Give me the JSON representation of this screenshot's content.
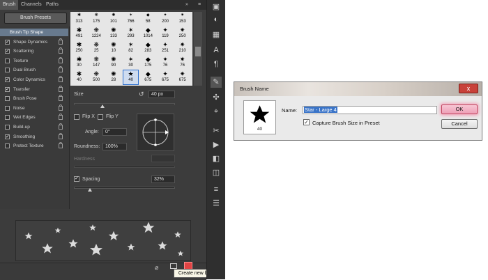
{
  "brush_panel": {
    "tabs": [
      "Brush",
      "Channels",
      "Paths"
    ],
    "presets_button": "Brush Presets",
    "options": [
      {
        "label": "Brush Tip Shape",
        "checked": null,
        "selected": true
      },
      {
        "label": "Shape Dynamics",
        "checked": true
      },
      {
        "label": "Scattering",
        "checked": true
      },
      {
        "label": "Texture",
        "checked": false
      },
      {
        "label": "Dual Brush",
        "checked": false
      },
      {
        "label": "Color Dynamics",
        "checked": true
      },
      {
        "label": "Transfer",
        "checked": true
      },
      {
        "label": "Brush Pose",
        "checked": false
      },
      {
        "label": "Noise",
        "checked": false
      },
      {
        "label": "Wet Edges",
        "checked": false
      },
      {
        "label": "Build-up",
        "checked": false
      },
      {
        "label": "Smoothing",
        "checked": true
      },
      {
        "label": "Protect Texture",
        "checked": false
      }
    ],
    "brush_grid": [
      [
        "313",
        "175",
        "101",
        "766",
        "58",
        "200",
        "153"
      ],
      [
        "491",
        "1224",
        "133",
        "293",
        "1014",
        "119",
        "250"
      ],
      [
        "250",
        "25",
        "10",
        "82",
        "283",
        "251",
        "210"
      ],
      [
        "30",
        "147",
        "90",
        "30",
        "175",
        "76",
        "76"
      ],
      [
        "40",
        "500",
        "28",
        "40",
        "675",
        "675",
        "675"
      ]
    ],
    "selected_brush_index": [
      4,
      3
    ],
    "size_label": "Size",
    "size_value": "40 px",
    "flip_x": "Flip X",
    "flip_y": "Flip Y",
    "angle_label": "Angle:",
    "angle_value": "0°",
    "roundness_label": "Roundness:",
    "roundness_value": "100%",
    "hardness_label": "Hardness",
    "spacing_label": "Spacing",
    "spacing_checked": true,
    "spacing_value": "32%",
    "size_level": 0.28,
    "spacing_level": 0.16,
    "tooltip": "Create new brush"
  },
  "dialog": {
    "title": "Brush Name",
    "close_symbol": "x",
    "thumb_size": "40",
    "name_label": "Name:",
    "name_value": "Star - Large 4",
    "capture_label": "Capture Brush Size in Preset",
    "capture_checked": true,
    "ok_label": "OK",
    "cancel_label": "Cancel"
  },
  "colors": {
    "panel_bg": "#3c3c3c",
    "selected_option": "#687a8e",
    "ok_highlight": "#ee9fb6",
    "name_selection": "#3a74c8"
  }
}
